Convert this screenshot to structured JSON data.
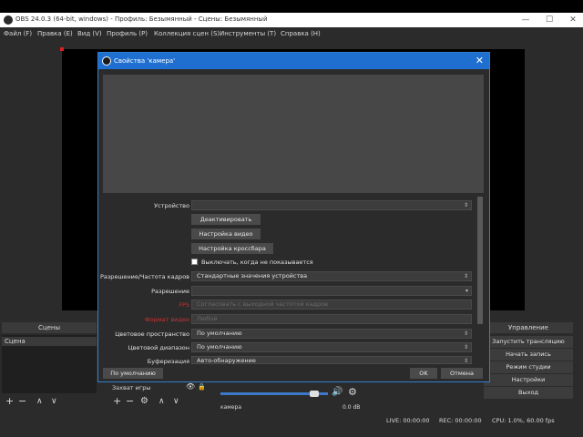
{
  "window": {
    "title": "OBS 24.0.3 (64-bit, windows) - Профиль: Безымянный - Сцены: Безымянный",
    "min": "—",
    "max": "☐",
    "close": "✕"
  },
  "menu": [
    "Файл (F)",
    "Правка (E)",
    "Вид (V)",
    "Профиль (P)",
    "Коллекция сцен (S)",
    "Инструменты (T)",
    "Справка (H)"
  ],
  "docks": {
    "scenes_header": "Сцены",
    "scene_item": "Сцена",
    "source_item": "Захват игры",
    "audio_label": "камера",
    "audio_value": "0.0 dB",
    "controls_header": "Управление"
  },
  "controls": [
    "Запустить трансляцию",
    "Начать запись",
    "Режим студии",
    "Настройки",
    "Выход"
  ],
  "status": {
    "live": "LIVE: 00:00:00",
    "rec": "REC: 00:00:00",
    "cpu": "CPU: 1.0%, 60.00 fps"
  },
  "dialog": {
    "title": "Свойства 'камера'",
    "close": "✕",
    "device_label": "Устройство",
    "device_value": "",
    "btn_deactivate": "Деактивировать",
    "btn_video_setup": "Настройка видео",
    "btn_crossbar": "Настройка кроссбара",
    "checkbox_label": "Выключать, когда не показывается",
    "res_fps_label": "Разрешение/Частота кадров",
    "res_fps_value": "Стандартные значения устройства",
    "resolution_label": "Разрешение",
    "resolution_value": "",
    "fps_label": "FPS",
    "fps_value": "Согласовать с выходной частотой кадров",
    "video_format_label": "Формат видео",
    "video_format_value": "Любой",
    "color_space_label": "Цветовое пространство",
    "color_space_value": "По умолчанию",
    "color_range_label": "Цветовой диапазон",
    "color_range_value": "По умолчанию",
    "buffering_label": "Буферизация",
    "buffering_value": "Авто-обнаружение",
    "defaults": "По умолчанию",
    "ok": "OK",
    "cancel": "Отмена"
  },
  "colors": {
    "accent": "#1e6fd0",
    "red_label": "#c83232"
  }
}
